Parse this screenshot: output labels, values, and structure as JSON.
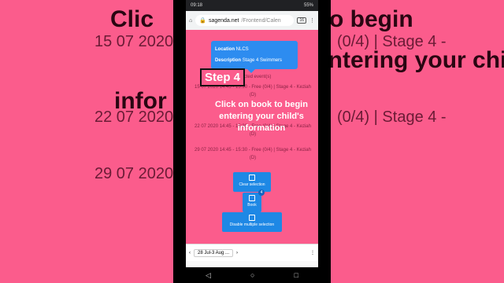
{
  "background": {
    "heading": "Click on book to begin entering your child's information",
    "heading_left": "Clic",
    "heading_right": "to begin",
    "line2_right": "entering your child's",
    "line3_left": "infor",
    "row1_left": "15 07 2020",
    "row1_right": "(0/4) | Stage 4 -",
    "row2_left": "22 07 2020",
    "row2_right": "(0/4) | Stage 4 -",
    "row3_left": "29 07 2020"
  },
  "status_bar": {
    "time": "09:18",
    "battery": "55%"
  },
  "browser": {
    "domain": "sagenda.net",
    "path": "/Frontend/Calen",
    "tab_count": "16"
  },
  "tooltip": {
    "location_label": "Location",
    "location_value": "NLCS",
    "description_label": "Description",
    "description_value": "Stage 4 Swimmers"
  },
  "events": {
    "header": "Selected event(s)",
    "items": [
      "15 07 2020 14:45 - 15:30 - Free (0/4) | Stage 4 - Keziah (D)",
      "22 07 2020 14:45 - 15:30 - Free (0/4) | Stage 4 - Keziah (D)",
      "29 07 2020 14:45 - 15:30 - Free (0/4) | Stage 4 - Keziah (D)"
    ]
  },
  "overlay": {
    "step": "Step 4",
    "instruction": "Click on book to begin entering your child's information"
  },
  "buttons": {
    "clear": "Clear selection",
    "book": "Book",
    "book_badge": "4",
    "disable": "Disable multiple selection"
  },
  "bottom_bar": {
    "date_range": "28 Jul-3 Aug ..."
  }
}
